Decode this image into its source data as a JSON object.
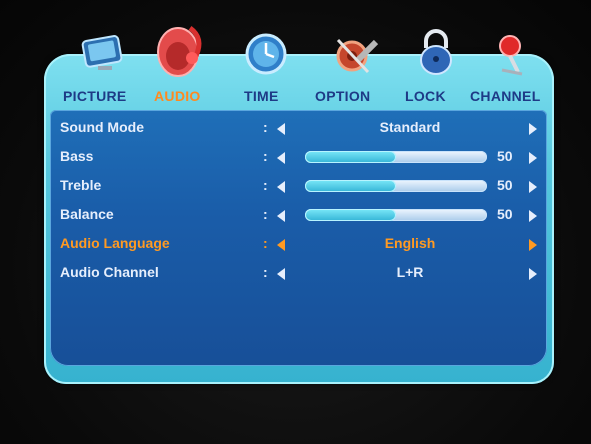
{
  "menu": {
    "tabs": [
      {
        "label": "PICTURE",
        "icon": "picture-icon",
        "active": false
      },
      {
        "label": "AUDIO",
        "icon": "audio-icon",
        "active": true
      },
      {
        "label": "TIME",
        "icon": "clock-icon",
        "active": false
      },
      {
        "label": "OPTION",
        "icon": "option-icon",
        "active": false
      },
      {
        "label": "LOCK",
        "icon": "lock-icon",
        "active": false
      },
      {
        "label": "CHANNEL",
        "icon": "channel-icon",
        "active": false
      }
    ]
  },
  "audio": {
    "items": [
      {
        "label": "Sound Mode",
        "type": "select",
        "value": "Standard"
      },
      {
        "label": "Bass",
        "type": "slider",
        "value": 50
      },
      {
        "label": "Treble",
        "type": "slider",
        "value": 50
      },
      {
        "label": "Balance",
        "type": "slider",
        "value": 50
      },
      {
        "label": "Audio Language",
        "type": "select",
        "value": "English",
        "selected": true
      },
      {
        "label": "Audio Channel",
        "type": "select",
        "value": "L+R"
      }
    ],
    "colon": ":"
  },
  "colors": {
    "active_tab": "#ff8a1f",
    "inactive_tab": "#1e3a86",
    "highlight": "#ff9a22",
    "panel": "#1a5da9",
    "frame": "#55c7de"
  }
}
